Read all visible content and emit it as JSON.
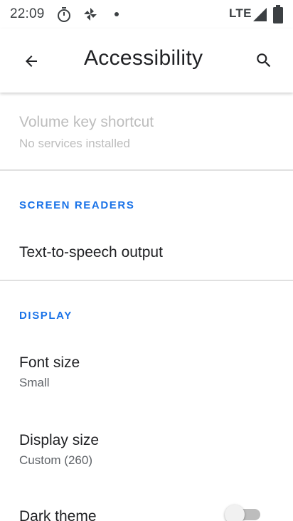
{
  "status_bar": {
    "time": "22:09",
    "network": "LTE",
    "icons": [
      "stopwatch-icon",
      "photos-icon",
      "dot-icon",
      "signal-icon",
      "battery-icon"
    ]
  },
  "app_bar": {
    "title": "Accessibility",
    "back_icon": "arrow-back-icon",
    "search_icon": "search-icon"
  },
  "preferences": {
    "volume_key_shortcut": {
      "title": "Volume key shortcut",
      "summary": "No services installed",
      "enabled": false
    },
    "screen_readers_header": "SCREEN READERS",
    "tts_output": {
      "title": "Text-to-speech output"
    },
    "display_header": "DISPLAY",
    "font_size": {
      "title": "Font size",
      "summary": "Small"
    },
    "display_size": {
      "title": "Display size",
      "summary": "Custom (260)"
    },
    "dark_theme": {
      "title": "Dark theme",
      "checked": false
    }
  },
  "colors": {
    "accent": "#1a73e8",
    "disabled_text": "#bdbdbd",
    "switch_off_track": "#bdbdbd"
  }
}
